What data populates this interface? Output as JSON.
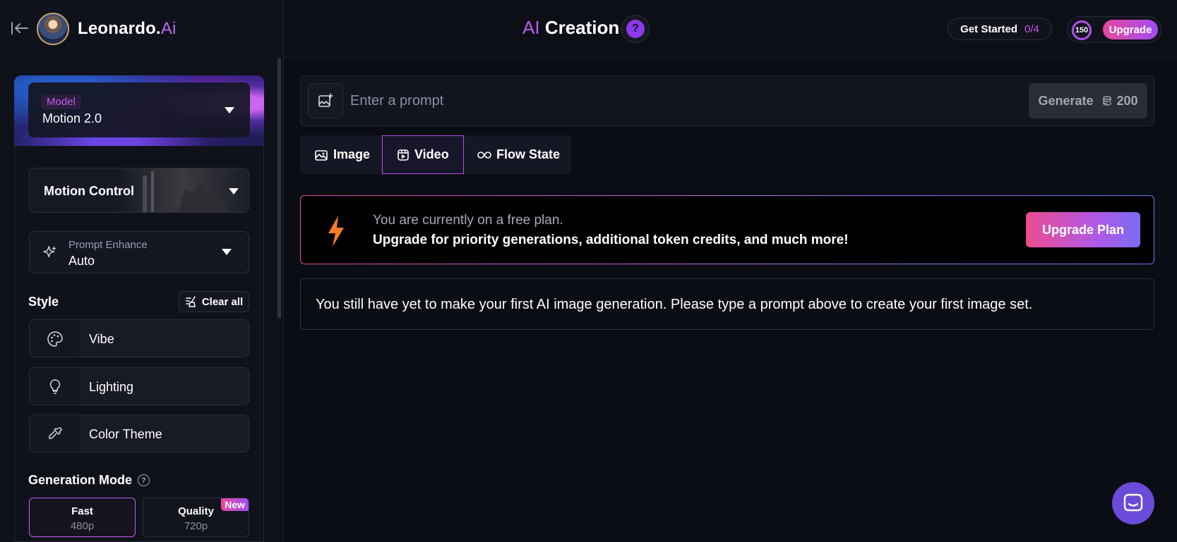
{
  "header": {
    "brand_name": "Leonardo.",
    "brand_suffix": "Ai",
    "title_prefix": "AI",
    "title_main": "Creation",
    "help_label": "?",
    "get_started_label": "Get Started",
    "get_started_progress": "0/4",
    "token_count": "150",
    "upgrade_label": "Upgrade"
  },
  "sidebar": {
    "model_tag": "Model",
    "model_value": "Motion 2.0",
    "motion_control_label": "Motion Control",
    "prompt_enhance_label": "Prompt Enhance",
    "prompt_enhance_value": "Auto",
    "style_heading": "Style",
    "clear_all_label": "Clear all",
    "style_items": [
      {
        "label": "Vibe",
        "icon": "palette-icon"
      },
      {
        "label": "Lighting",
        "icon": "lightbulb-icon"
      },
      {
        "label": "Color Theme",
        "icon": "eyedropper-icon"
      }
    ],
    "generation_mode_heading": "Generation Mode",
    "modes": [
      {
        "title": "Fast",
        "subtitle": "480p",
        "selected": true
      },
      {
        "title": "Quality",
        "subtitle": "720p",
        "badge": "New",
        "selected": false
      }
    ]
  },
  "main": {
    "prompt_placeholder": "Enter a prompt",
    "generate_label": "Generate",
    "generate_cost": "200",
    "tabs": [
      {
        "label": "Image",
        "icon": "image-icon",
        "active": false
      },
      {
        "label": "Video",
        "icon": "video-icon",
        "active": true
      },
      {
        "label": "Flow State",
        "icon": "infinity-icon",
        "active": false
      }
    ],
    "banner_line1": "You are currently on a free plan.",
    "banner_line2": "Upgrade for priority generations, additional token credits, and much more!",
    "upgrade_plan_label": "Upgrade Plan",
    "empty_message": "You still have yet to make your first AI image generation. Please type a prompt above to create your first image set."
  },
  "colors": {
    "accent_purple": "#c157f5",
    "upgrade_gradient_start": "#e7489d",
    "upgrade_gradient_end": "#a24cf3",
    "bolt_orange": "#f47c2c",
    "chat_fab": "#6b4bd9"
  }
}
